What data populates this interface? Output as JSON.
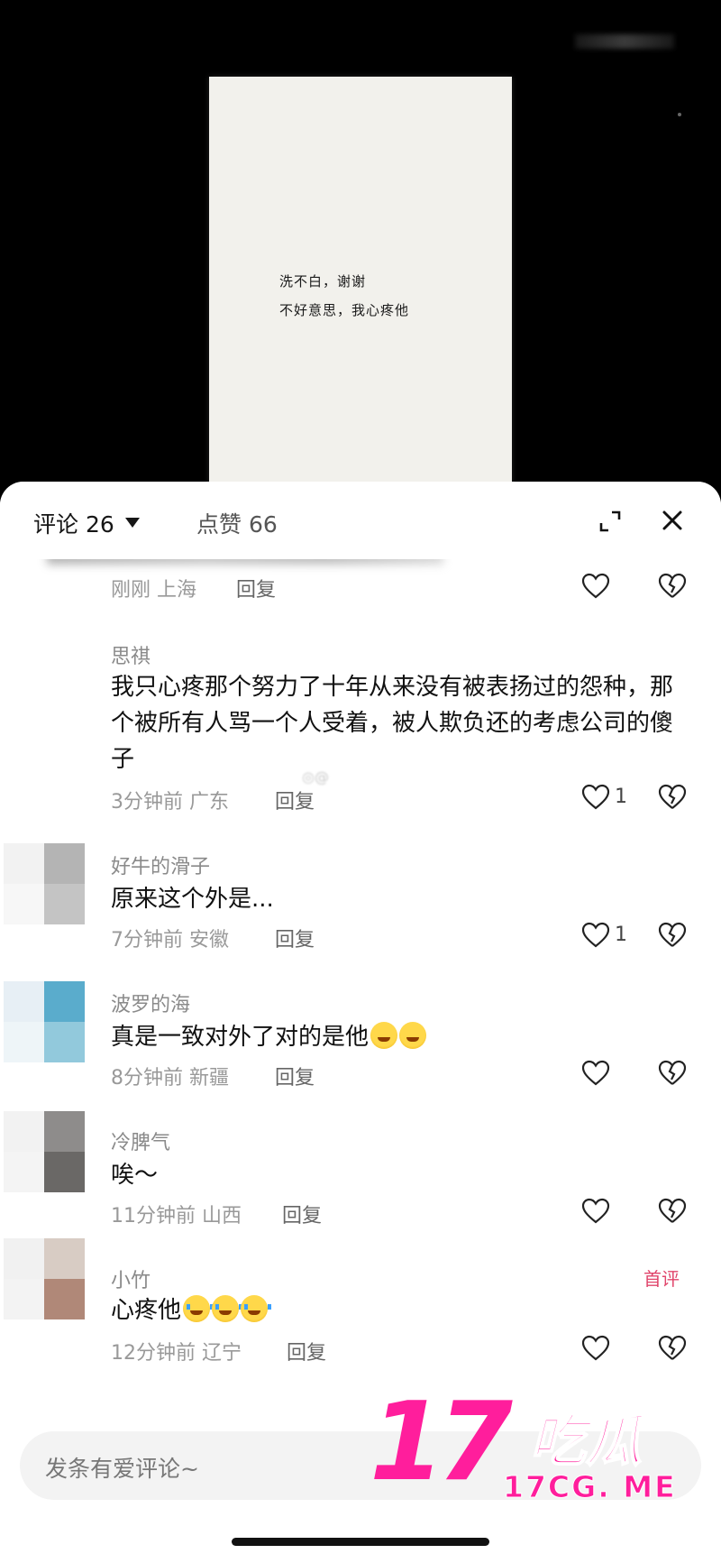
{
  "video": {
    "card_line1": "洗不白，谢谢",
    "card_line2": "不好意思，我心疼他"
  },
  "header": {
    "comments_tab": "评论 26",
    "likes_tab": "点赞 66"
  },
  "comments": [
    {
      "name": "",
      "text": "",
      "time": "刚刚",
      "location": "上海",
      "reply": "回复",
      "likes": ""
    },
    {
      "name": "思祺",
      "text": "我只心疼那个努力了十年从来没有被表扬过的怨种，那个被所有人骂一个人受着，被人欺负还的考虑公司的傻子",
      "time": "3分钟前",
      "location": "广东",
      "reply": "回复",
      "likes": "1"
    },
    {
      "name": "好牛的滑子",
      "text": "原来这个外是...",
      "time": "7分钟前",
      "location": "安徽",
      "reply": "回复",
      "likes": "1"
    },
    {
      "name": "波罗的海",
      "text": "真是一致对外了对的是他",
      "time": "8分钟前",
      "location": "新疆",
      "reply": "回复",
      "likes": ""
    },
    {
      "name": "冷脾气",
      "text": "唉～",
      "time": "11分钟前",
      "location": "山西",
      "reply": "回复",
      "likes": ""
    },
    {
      "name": "小竹",
      "text": "心疼他",
      "time": "12分钟前",
      "location": "辽宁",
      "reply": "回复",
      "likes": "",
      "badge": "首评"
    }
  ],
  "input": {
    "placeholder": "发条有爱评论~"
  },
  "watermark": {
    "number": "17",
    "name": "吃瓜",
    "url": "17CG. ME"
  },
  "colors": {
    "accent": "#ff1e9c",
    "badge": "#e0456b"
  },
  "icons": [
    "expand-icon",
    "close-icon",
    "heart-icon",
    "broken-heart-icon",
    "caret-down-icon"
  ]
}
